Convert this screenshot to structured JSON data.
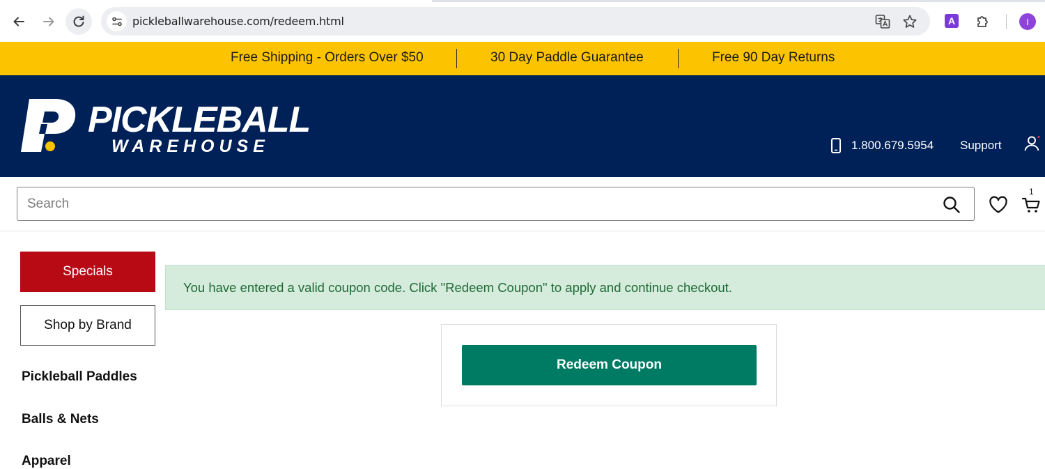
{
  "browser": {
    "url": "pickleballwarehouse.com/redeem.html",
    "profile_initial": "I",
    "extension_badge": "A"
  },
  "promo_bar": {
    "items": [
      "Free Shipping - Orders Over $50",
      "30 Day Paddle Guarantee",
      "Free 90 Day Returns"
    ]
  },
  "header": {
    "logo_line1": "PICKLEBALL",
    "logo_line2": "WAREHOUSE",
    "phone": "1.800.679.5954",
    "support_label": "Support"
  },
  "search": {
    "placeholder": "Search",
    "value": ""
  },
  "cart": {
    "count": "1"
  },
  "sidebar": {
    "specials_label": "Specials",
    "brand_label": "Shop by Brand",
    "links": [
      "Pickleball Paddles",
      "Balls & Nets",
      "Apparel"
    ]
  },
  "main": {
    "alert_text": "You have entered a valid coupon code. Click \"Redeem Coupon\" to apply and continue checkout.",
    "redeem_label": "Redeem Coupon"
  },
  "colors": {
    "promo_bg": "#fcc400",
    "header_bg": "#002157",
    "specials_bg": "#b80a14",
    "alert_bg": "#d5ebdc",
    "alert_text": "#1f6a36",
    "redeem_bg": "#007b63"
  },
  "icons": [
    "back-icon",
    "forward-icon",
    "reload-icon",
    "site-info-icon",
    "translate-icon",
    "star-icon",
    "extension-icon",
    "puzzle-icon",
    "phone-icon",
    "user-icon",
    "search-icon",
    "heart-icon",
    "cart-icon"
  ]
}
